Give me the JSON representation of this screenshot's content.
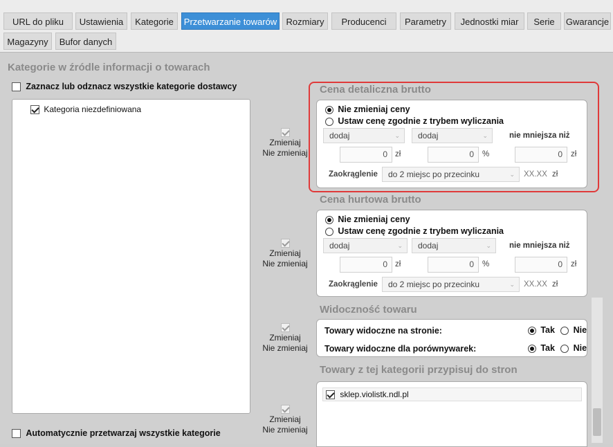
{
  "tabs": [
    {
      "label": "URL do pliku",
      "active": false
    },
    {
      "label": "Ustawienia",
      "active": false
    },
    {
      "label": "Kategorie",
      "active": false
    },
    {
      "label": "Przetwarzanie towarów",
      "active": true
    },
    {
      "label": "Rozmiary",
      "active": false
    },
    {
      "label": "Producenci",
      "active": false
    },
    {
      "label": "Parametry",
      "active": false
    },
    {
      "label": "Jednostki miar",
      "active": false
    },
    {
      "label": "Serie",
      "active": false
    },
    {
      "label": "Gwarancje",
      "active": false
    },
    {
      "label": "Magazyny",
      "active": false
    },
    {
      "label": "Bufor danych",
      "active": false
    }
  ],
  "left": {
    "title": "Kategorie w źródle informacji o towarach",
    "select_all_label": "Zaznacz lub odznacz wszystkie kategorie dostawcy",
    "categories": [
      {
        "label": "Kategoria niezdefiniowana",
        "checked": true
      }
    ],
    "auto_process_label": "Automatycznie przetwarzaj wszystkie kategorie"
  },
  "toggle_label": {
    "line1": "Zmieniaj",
    "line2": "Nie zmieniaj"
  },
  "retail": {
    "title": "Cena detaliczna brutto",
    "opt_keep": "Nie zmieniaj ceny",
    "opt_calc": "Ustaw cenę zgodnie z trybem wyliczania",
    "op1": "dodaj",
    "op2": "dodaj",
    "min_label": "nie mniejsza niż",
    "val1": "0",
    "unit1": "zł",
    "val2": "0",
    "unit2": "%",
    "val3": "0",
    "unit3": "zł",
    "round_label": "Zaokrąglenie",
    "round_value": "do 2 miejsc po przecinku",
    "round_fmt": "XX.XX",
    "round_unit": "zł"
  },
  "wholesale": {
    "title": "Cena hurtowa brutto",
    "opt_keep": "Nie zmieniaj ceny",
    "opt_calc": "Ustaw cenę zgodnie z trybem wyliczania",
    "op1": "dodaj",
    "op2": "dodaj",
    "min_label": "nie mniejsza niż",
    "val1": "0",
    "unit1": "zł",
    "val2": "0",
    "unit2": "%",
    "val3": "0",
    "unit3": "zł",
    "round_label": "Zaokrąglenie",
    "round_value": "do 2 miejsc po przecinku",
    "round_fmt": "XX.XX",
    "round_unit": "zł"
  },
  "visibility": {
    "title": "Widoczność towaru",
    "row1": "Towary widoczne na stronie:",
    "row2": "Towary widoczne dla porównywarek:",
    "yes": "Tak",
    "no": "Nie"
  },
  "stores": {
    "title": "Towary z tej kategorii przypisuj do stron",
    "items": [
      {
        "label": "sklep.violistk.ndl.pl",
        "checked": true
      }
    ]
  }
}
